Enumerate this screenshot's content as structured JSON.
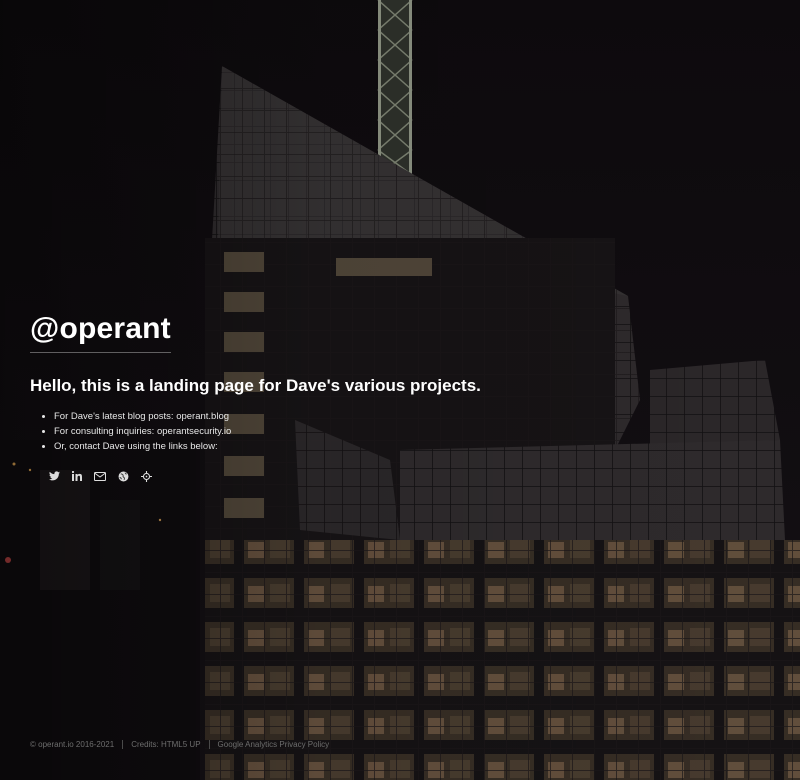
{
  "site": {
    "title": "@operant",
    "tagline": "Hello, this is a landing page for Dave's various projects."
  },
  "links": [
    {
      "text": "For Dave's latest blog posts: operant.blog"
    },
    {
      "text": "For consulting inquiries: operantsecurity.io"
    },
    {
      "text": "Or, contact Dave using the links below:"
    }
  ],
  "social_icons": [
    "twitter-icon",
    "linkedin-icon",
    "envelope-icon",
    "globe-icon",
    "crosshair-icon"
  ],
  "footer": {
    "copyright": "© operant.io 2016-2021",
    "credits": "Credits: HTML5 UP",
    "privacy": "Google Analytics Privacy Policy"
  },
  "colors": {
    "background": "#0c0a0d",
    "text": "#ffffff",
    "footer_text": "#6d6d6d"
  }
}
